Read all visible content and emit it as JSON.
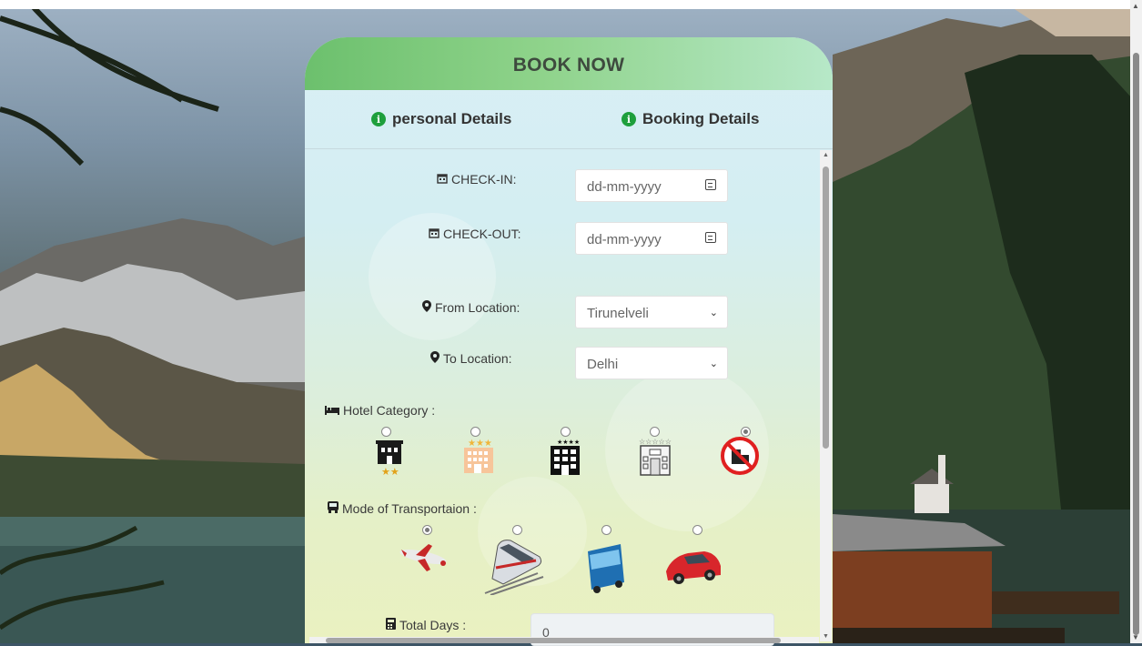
{
  "card": {
    "title": "BOOK NOW",
    "tabs": [
      {
        "label": "personal Details",
        "icon": "info-icon"
      },
      {
        "label": "Booking Details",
        "icon": "info-icon"
      }
    ]
  },
  "form": {
    "check_in": {
      "label": "CHECK-IN:",
      "placeholder": "dd-mm-yyyy",
      "icon": "calendar-icon"
    },
    "check_out": {
      "label": "CHECK-OUT:",
      "placeholder": "dd-mm-yyyy",
      "icon": "calendar-icon"
    },
    "from_location": {
      "label": "From Location:",
      "value": "Tirunelveli",
      "icon": "map-marker-icon"
    },
    "to_location": {
      "label": "To Location:",
      "value": "Delhi",
      "icon": "map-marker-icon"
    },
    "hotel_category": {
      "label": "Hotel Category :",
      "icon": "bed-icon",
      "options": [
        {
          "name": "2-star-hotel",
          "selected": false
        },
        {
          "name": "3-star-hotel",
          "selected": false
        },
        {
          "name": "4-star-hotel",
          "selected": false
        },
        {
          "name": "5-star-hotel",
          "selected": false
        },
        {
          "name": "no-hotel",
          "selected": true
        }
      ]
    },
    "transport": {
      "label": "Mode of Transportaion :",
      "icon": "bus-icon",
      "options": [
        {
          "name": "flight",
          "selected": true
        },
        {
          "name": "train",
          "selected": false
        },
        {
          "name": "bus",
          "selected": false
        },
        {
          "name": "car",
          "selected": false
        }
      ]
    },
    "total_days": {
      "label": "Total Days :",
      "value": "0",
      "icon": "calculator-icon"
    }
  },
  "colors": {
    "header_green": "#6cc06d",
    "info_icon": "#1e9f3c"
  }
}
